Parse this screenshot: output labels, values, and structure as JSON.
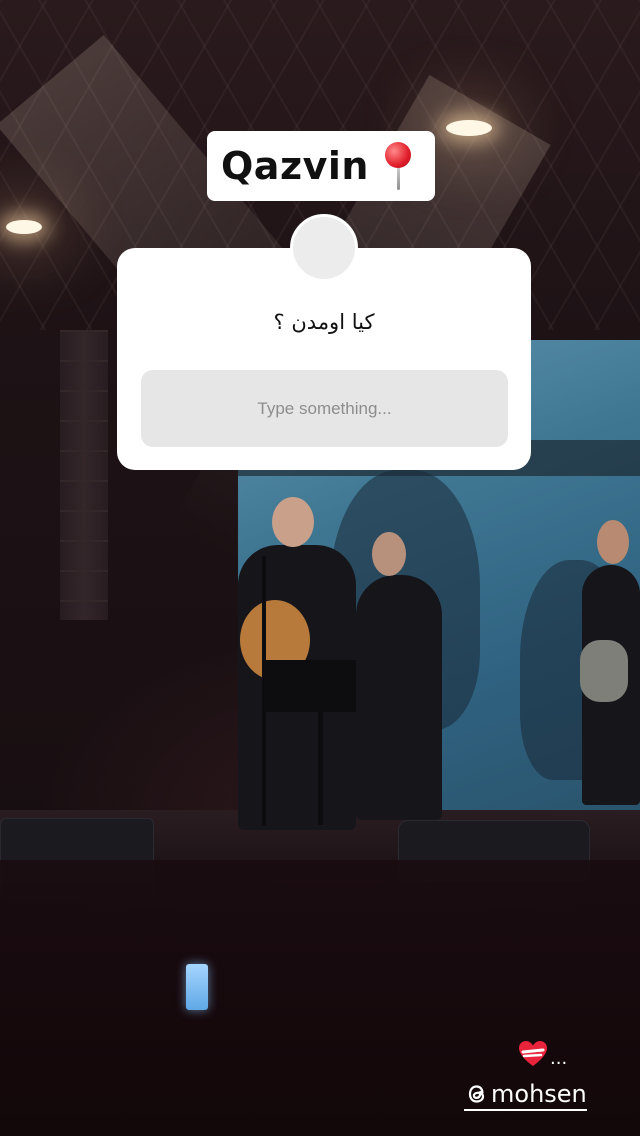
{
  "location_sticker": {
    "text": "Qazvin",
    "icon": "round-pushpin-icon"
  },
  "question_sticker": {
    "question": "کیا اومدن ؟",
    "input_placeholder": "Type something..."
  },
  "heart_sticker": {
    "icon": "mending-heart-icon",
    "trailing_text": "..."
  },
  "mention": {
    "icon": "threads-icon",
    "username": "mohsen"
  },
  "colors": {
    "sticker_background": "#ffffff",
    "input_background": "#e6e6e6",
    "placeholder_text": "#8d8d8d",
    "pin_red": "#e11d2a"
  }
}
